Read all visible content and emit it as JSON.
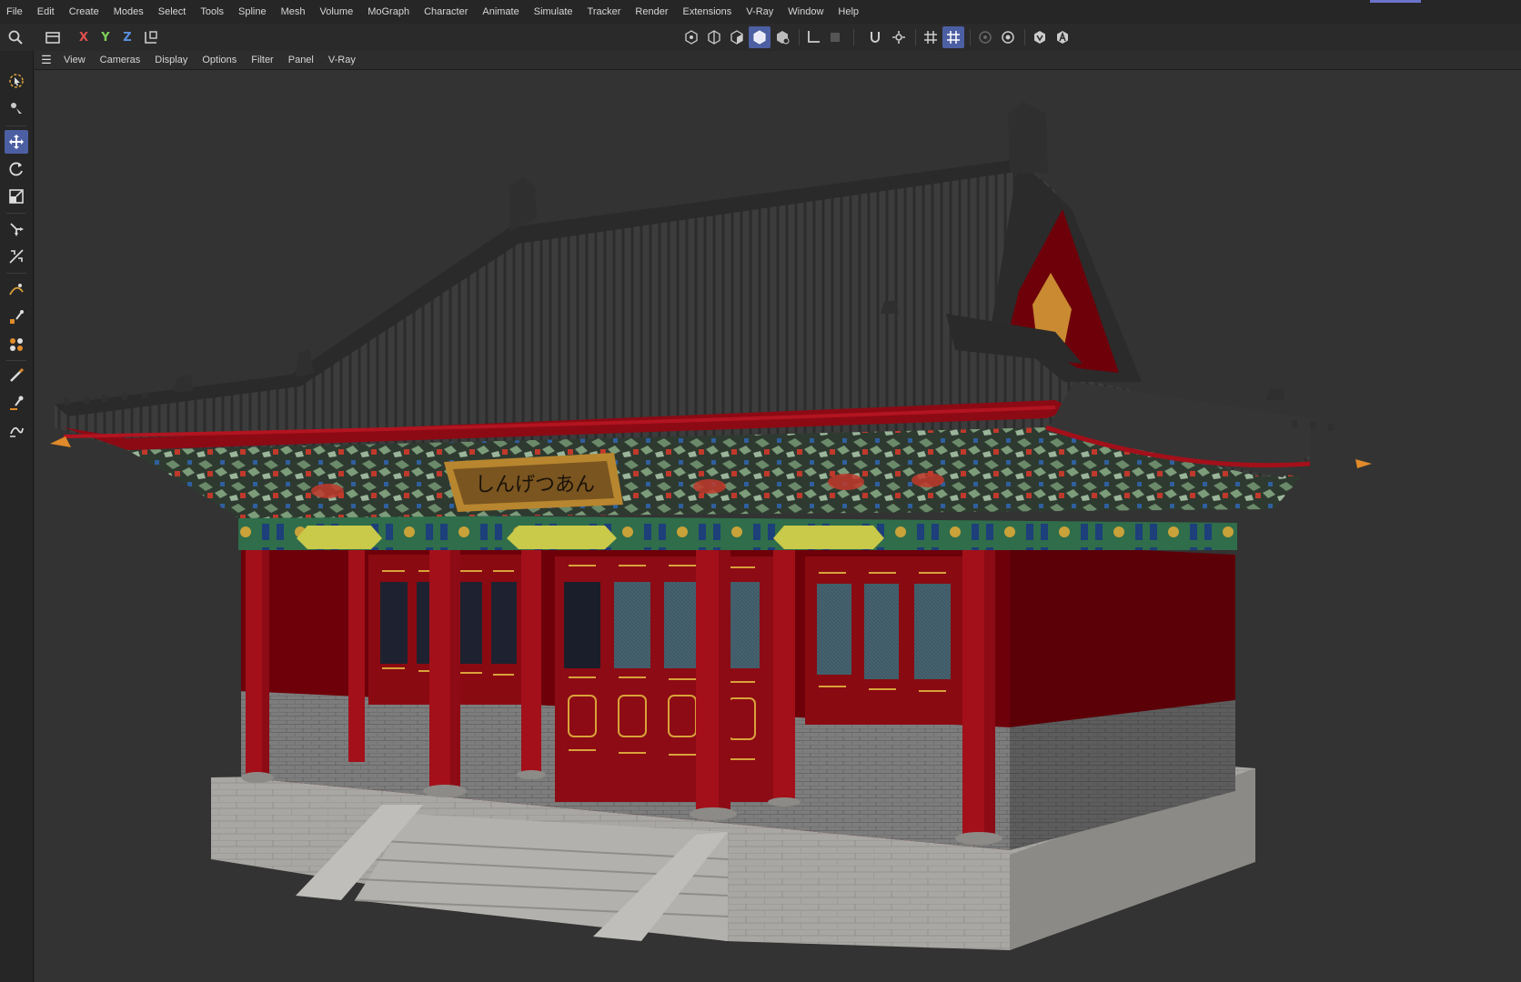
{
  "menu": [
    "File",
    "Edit",
    "Create",
    "Modes",
    "Select",
    "Tools",
    "Spline",
    "Mesh",
    "Volume",
    "MoGraph",
    "Character",
    "Animate",
    "Simulate",
    "Tracker",
    "Render",
    "Extensions",
    "V-Ray",
    "Window",
    "Help"
  ],
  "axes": {
    "x": "X",
    "y": "Y",
    "z": "Z"
  },
  "axis_colors": {
    "x": "#e05050",
    "y": "#7fd05a",
    "z": "#5a8fe0"
  },
  "view_menu": [
    "View",
    "Cameras",
    "Display",
    "Options",
    "Filter",
    "Panel",
    "V-Ray"
  ],
  "accent_color": "#4d5fa3",
  "scene": {
    "plaque_text": "しんげつあん",
    "colors": {
      "roof": "#3a3a3a",
      "column": "#a3101a",
      "wall": "#7a0009",
      "brick": "#8a8a8a",
      "stone": "#a8a6a2",
      "gold": "#d9a23a"
    }
  }
}
